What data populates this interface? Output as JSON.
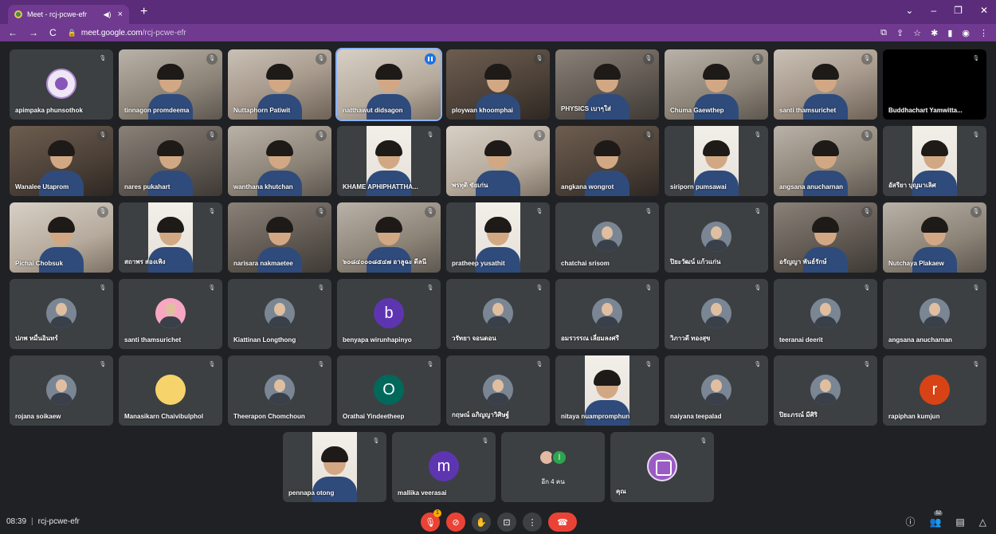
{
  "browser": {
    "tab_title": "Meet - rcj-pcwe-efr",
    "url_host": "meet.google.com",
    "url_path": "/rcj-pcwe-efr"
  },
  "tiles": [
    {
      "name": "apimpaka phunsothok",
      "kind": "avatar",
      "style": "logo",
      "mic": "off"
    },
    {
      "name": "tinnagon promdeema",
      "kind": "video",
      "mic": "off"
    },
    {
      "name": "Nuttaphorn Patiwit",
      "kind": "video",
      "mic": "off"
    },
    {
      "name": "natthawut didsagon",
      "kind": "video",
      "mic": "speaking",
      "active": true
    },
    {
      "name": "ploywan khoomphai",
      "kind": "video",
      "mic": "off"
    },
    {
      "name": "PHYSICS เบาๆใส่",
      "kind": "video",
      "mic": "off"
    },
    {
      "name": "Chuma Gaewthep",
      "kind": "video",
      "mic": "off"
    },
    {
      "name": "santi thamsurichet",
      "kind": "video",
      "mic": "off"
    },
    {
      "name": "Buddhachart Yamwitta...",
      "kind": "black",
      "mic": "off"
    },
    {
      "name": "Wanalee Utaprom",
      "kind": "video",
      "mic": "off"
    },
    {
      "name": "nares pukahart",
      "kind": "video",
      "mic": "off"
    },
    {
      "name": "wanthana khutchan",
      "kind": "video",
      "mic": "off"
    },
    {
      "name": "KHAME APHIPHATTHA...",
      "kind": "portrait",
      "mic": "off"
    },
    {
      "name": "พรทุติ ขัยเก่น",
      "kind": "video",
      "mic": "off"
    },
    {
      "name": "angkana wongrot",
      "kind": "video",
      "mic": "off"
    },
    {
      "name": "siriporn pumsawai",
      "kind": "portrait",
      "mic": "off"
    },
    {
      "name": "angsana anucharnan",
      "kind": "video",
      "mic": "off"
    },
    {
      "name": "อัสรียา บุญมาเลิศ",
      "kind": "portrait",
      "mic": "off"
    },
    {
      "name": "Pichai Chobsuk",
      "kind": "video",
      "mic": "off"
    },
    {
      "name": "สถาพร ส่องเพิง",
      "kind": "portrait",
      "mic": "off"
    },
    {
      "name": "narisara nakmaetee",
      "kind": "video",
      "mic": "off"
    },
    {
      "name": "๖๐๘๔๐๐๐๘๕๔๗ อาลูฉะ ดีลนี",
      "kind": "video",
      "mic": "off"
    },
    {
      "name": "pratheep yusathit",
      "kind": "portrait",
      "mic": "off"
    },
    {
      "name": "chatchai srisom",
      "kind": "avatar",
      "style": "photo",
      "mic": "off"
    },
    {
      "name": "ปิยะวัฒน์ แก้วแก่น",
      "kind": "avatar",
      "style": "photo",
      "mic": "off"
    },
    {
      "name": "อรัญญา พันธ์รักษ์",
      "kind": "video",
      "mic": "off"
    },
    {
      "name": "Nutchaya Plakaew",
      "kind": "video",
      "mic": "off"
    },
    {
      "name": "ปภพ หมื่นอินทร์",
      "kind": "avatar",
      "style": "photo",
      "mic": "off"
    },
    {
      "name": "santi thamsurichet",
      "kind": "avatar",
      "style": "emoji",
      "mic": "off"
    },
    {
      "name": "Kiattinan Longthong",
      "kind": "avatar",
      "style": "photo",
      "mic": "off"
    },
    {
      "name": "benyapa wirunhapinyo",
      "kind": "avatar",
      "style": "letter",
      "letter": "b",
      "color": "#5e35b1",
      "mic": "off"
    },
    {
      "name": "วรัทยา จอนดอน",
      "kind": "avatar",
      "style": "photo",
      "mic": "off"
    },
    {
      "name": "อมรวรรณ เลี่ยมลงศรี",
      "kind": "avatar",
      "style": "photo",
      "mic": "off"
    },
    {
      "name": "วิภาวดี ทองสุข",
      "kind": "avatar",
      "style": "photo",
      "mic": "off"
    },
    {
      "name": "teeranai deerit",
      "kind": "avatar",
      "style": "photo",
      "mic": "off"
    },
    {
      "name": "angsana anucharnan",
      "kind": "avatar",
      "style": "photo",
      "mic": "off"
    },
    {
      "name": "rojana soikaew",
      "kind": "avatar",
      "style": "photo",
      "mic": "off"
    },
    {
      "name": "Manasikarn Chaivibulphol",
      "kind": "avatar",
      "style": "bear",
      "mic": "off"
    },
    {
      "name": "Theerapon Chomchoun",
      "kind": "avatar",
      "style": "photo",
      "mic": "off"
    },
    {
      "name": "Orathai Yindeetheep",
      "kind": "avatar",
      "style": "letter",
      "letter": "O",
      "color": "#00695c",
      "mic": "off"
    },
    {
      "name": "กฤษณ์ อภิญญาวิศิษฐ์",
      "kind": "avatar",
      "style": "photo",
      "mic": "off"
    },
    {
      "name": "nitaya nuampromphun",
      "kind": "portrait",
      "mic": "off"
    },
    {
      "name": "naiyana teepalad",
      "kind": "avatar",
      "style": "photo",
      "mic": "off"
    },
    {
      "name": "ปิยะภรณ์ มีศิริ",
      "kind": "avatar",
      "style": "photo",
      "mic": "off"
    },
    {
      "name": "rapiphan kumjun",
      "kind": "avatar",
      "style": "letter",
      "letter": "r",
      "color": "#d84315",
      "mic": "off"
    },
    {
      "name": "pennapa otong",
      "kind": "portrait",
      "mic": "off"
    },
    {
      "name": "mallika veerasai",
      "kind": "avatar",
      "style": "letter",
      "letter": "m",
      "color": "#5e35b1",
      "mic": "off"
    },
    {
      "name": "",
      "kind": "more",
      "more_label": "อีก 4 คน",
      "mini_letter": "l",
      "mic": "none"
    },
    {
      "name": "คุณ",
      "kind": "avatar",
      "style": "school",
      "mic": "off"
    }
  ],
  "footer": {
    "time": "08:39",
    "meeting_code": "rcj-pcwe-efr",
    "participant_count": "52",
    "mic_badge": "1"
  },
  "icons": {
    "mic_off": "mic-off-icon",
    "speaking": "audio-level-icon"
  }
}
